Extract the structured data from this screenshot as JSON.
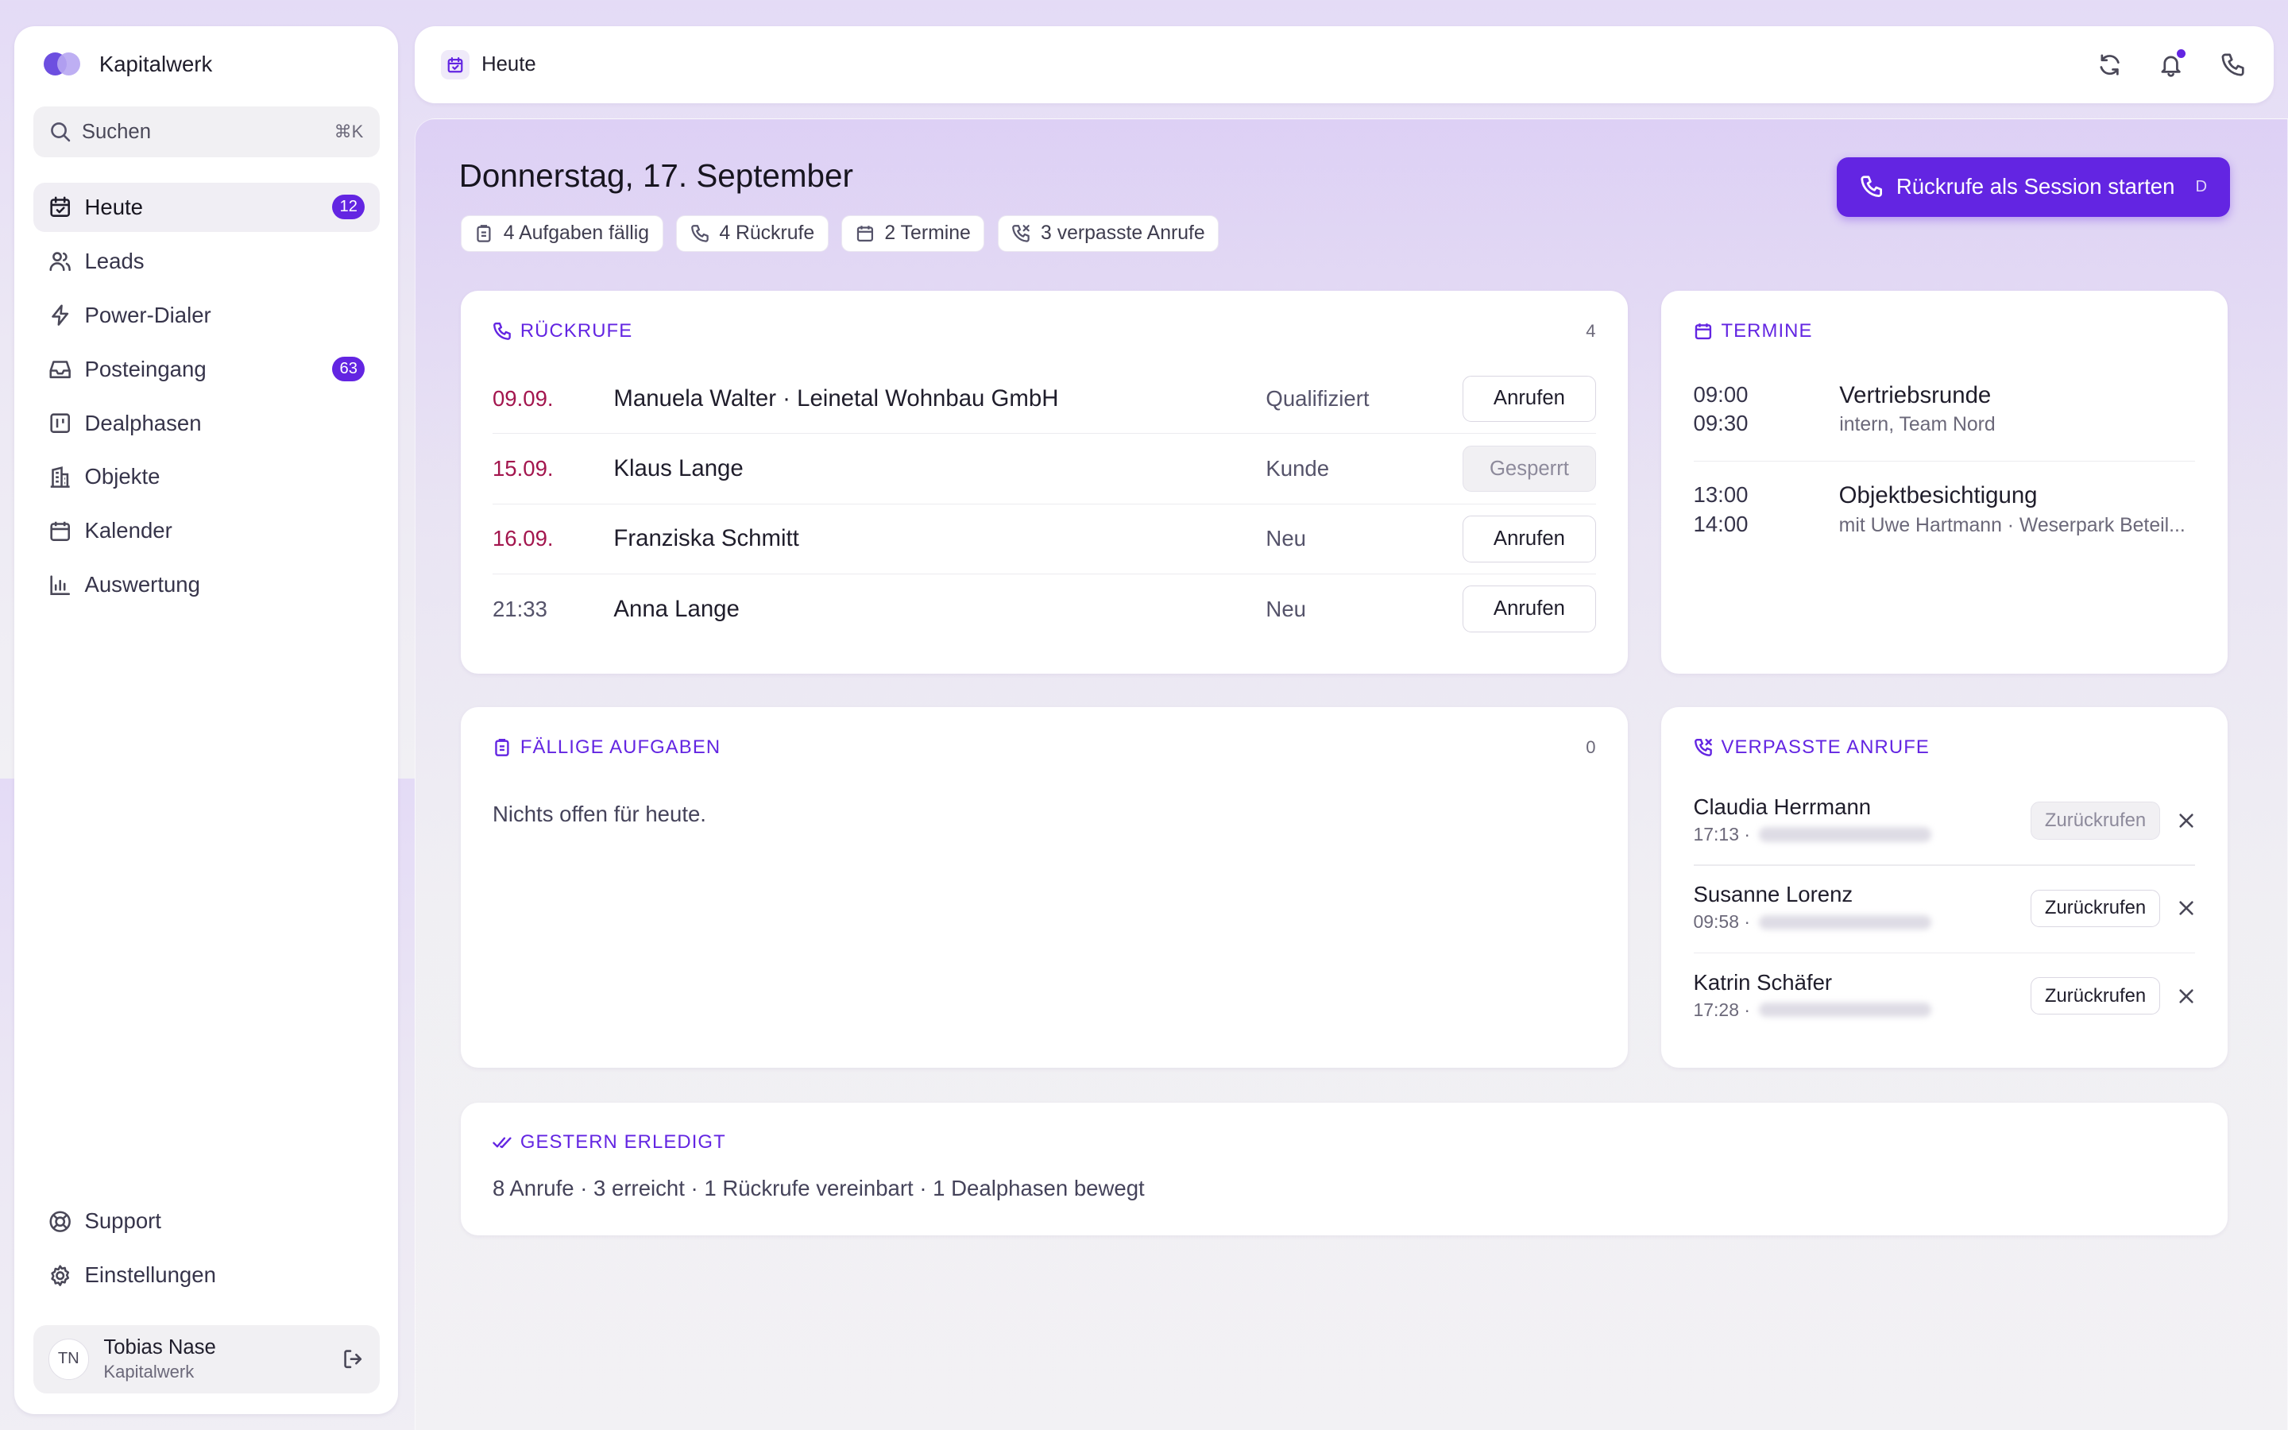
{
  "brand": {
    "name": "Kapitalwerk"
  },
  "search": {
    "placeholder": "Suchen",
    "shortcut": "⌘K"
  },
  "nav": [
    {
      "label": "Heute",
      "icon": "calendar-check-icon",
      "badge": "12",
      "active": true
    },
    {
      "label": "Leads",
      "icon": "users-icon"
    },
    {
      "label": "Power-Dialer",
      "icon": "lightning-icon"
    },
    {
      "label": "Posteingang",
      "icon": "inbox-icon",
      "badge": "63"
    },
    {
      "label": "Dealphasen",
      "icon": "kanban-icon"
    },
    {
      "label": "Objekte",
      "icon": "building-icon"
    },
    {
      "label": "Kalender",
      "icon": "calendar-icon"
    },
    {
      "label": "Auswertung",
      "icon": "bar-chart-icon"
    }
  ],
  "nav_bottom": [
    {
      "label": "Support",
      "icon": "lifebuoy-icon"
    },
    {
      "label": "Einstellungen",
      "icon": "gear-icon"
    }
  ],
  "user": {
    "initials": "TN",
    "name": "Tobias Nase",
    "org": "Kapitalwerk"
  },
  "topbar": {
    "title": "Heute"
  },
  "header": {
    "date": "Donnerstag, 17. September",
    "chips": [
      "4 Aufgaben fällig",
      "4 Rückrufe",
      "2 Termine",
      "3 verpasste Anrufe"
    ],
    "cta_label": "Rückrufe als Session starten",
    "cta_key": "D"
  },
  "callbacks": {
    "title": "RÜCKRUFE",
    "count": "4",
    "rows": [
      {
        "date": "09.09.",
        "name": "Manuela Walter · Leinetal Wohnbau GmbH",
        "status": "Qualifiziert",
        "action": "Anrufen",
        "overdue": true,
        "disabled": false
      },
      {
        "date": "15.09.",
        "name": "Klaus Lange",
        "status": "Kunde",
        "action": "Gesperrt",
        "overdue": true,
        "disabled": true
      },
      {
        "date": "16.09.",
        "name": "Franziska Schmitt",
        "status": "Neu",
        "action": "Anrufen",
        "overdue": true,
        "disabled": false
      },
      {
        "date": "21:33",
        "name": "Anna Lange",
        "status": "Neu",
        "action": "Anrufen",
        "overdue": false,
        "disabled": false
      }
    ]
  },
  "appointments": {
    "title": "TERMINE",
    "items": [
      {
        "start": "09:00",
        "end": "09:30",
        "title": "Vertriebsrunde",
        "sub": "intern, Team Nord"
      },
      {
        "start": "13:00",
        "end": "14:00",
        "title": "Objektbesichtigung",
        "sub": "mit Uwe Hartmann · Weserpark Beteil..."
      }
    ]
  },
  "tasks": {
    "title": "FÄLLIGE AUFGABEN",
    "count": "0",
    "empty": "Nichts offen für heute."
  },
  "missed": {
    "title": "VERPASSTE ANRUFE",
    "items": [
      {
        "name": "Claudia Herrmann",
        "time": "17:13 ·",
        "action": "Zurückrufen",
        "disabled": true
      },
      {
        "name": "Susanne Lorenz",
        "time": "09:58 ·",
        "action": "Zurückrufen",
        "disabled": false
      },
      {
        "name": "Katrin Schäfer",
        "time": "17:28 ·",
        "action": "Zurückrufen",
        "disabled": false
      }
    ]
  },
  "yesterday": {
    "title": "GESTERN ERLEDIGT",
    "summary": "8 Anrufe · 3 erreicht · 1 Rückrufe vereinbart · 1 Dealphasen bewegt"
  },
  "colors": {
    "accent": "#6325e2",
    "overdue": "#a3164e"
  }
}
